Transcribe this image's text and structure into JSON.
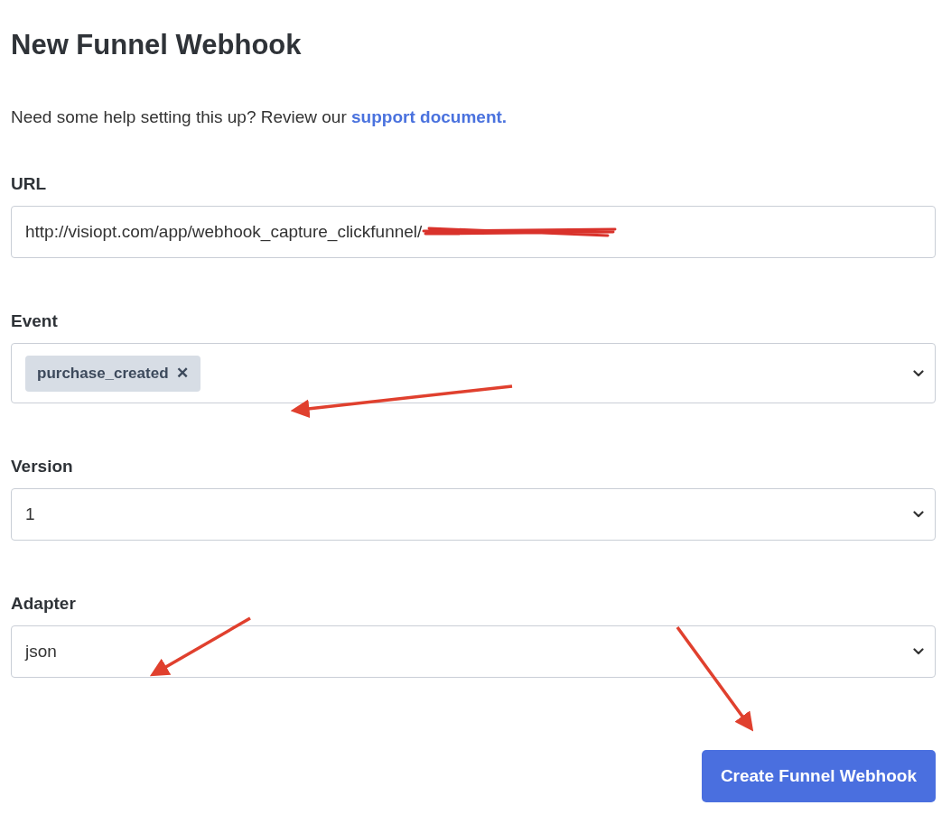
{
  "title": "New Funnel Webhook",
  "help": {
    "text": "Need some help setting this up? Review our",
    "link": "support document."
  },
  "fields": [
    {
      "kind": "text",
      "label": "URL",
      "value": "http://visiopt.com/app/webhook_capture_clickfunnel/",
      "redacted": true
    },
    {
      "kind": "tags",
      "label": "Event",
      "tags": [
        {
          "label": "purchase_created",
          "remove": "✕"
        }
      ]
    },
    {
      "kind": "select",
      "label": "Version",
      "value": "1"
    },
    {
      "kind": "select",
      "label": "Adapter",
      "value": "json"
    }
  ],
  "submit": "Create Funnel Webhook"
}
